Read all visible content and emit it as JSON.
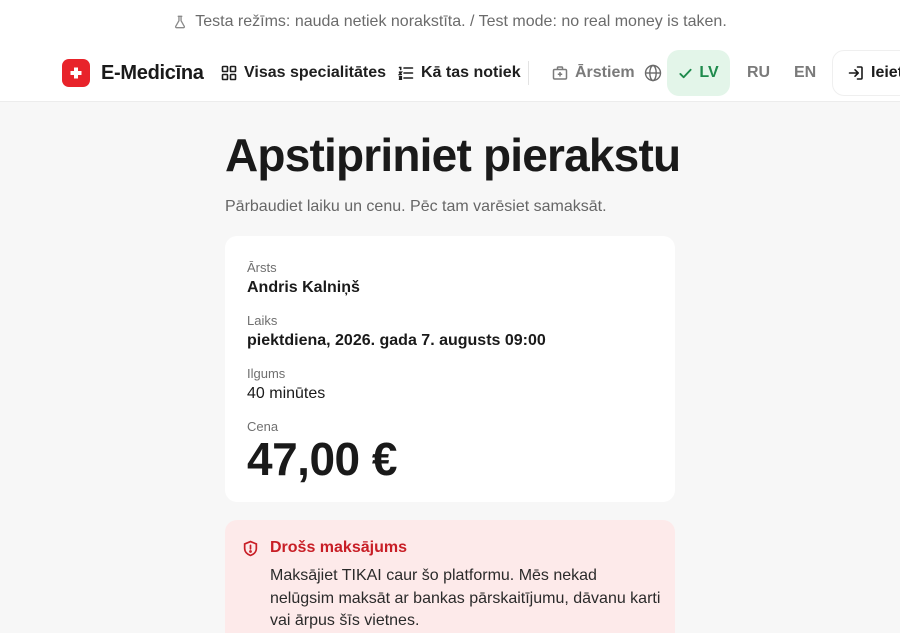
{
  "banner": {
    "text": "Testa režīms: nauda netiek norakstīta. / Test mode: no real money is taken.",
    "icon": "flask-icon"
  },
  "nav": {
    "brand": "E-Medicīna",
    "specialties": "Visas specialitātes",
    "how_it_works": "Kā tas notiek",
    "for_doctors": "Ārstiem",
    "languages": {
      "lv": "LV",
      "ru": "RU",
      "en": "EN",
      "active": "LV"
    },
    "login": "Ieiet"
  },
  "page": {
    "title": "Apstipriniet pierakstu",
    "subtitle": "Pārbaudiet laiku un cenu. Pēc tam varēsiet samaksāt."
  },
  "details": {
    "doctor_label": "Ārsts",
    "doctor_value": "Andris Kalniņš",
    "time_label": "Laiks",
    "time_value": "piektdiena, 2026. gada 7. augusts 09:00",
    "duration_label": "Ilgums",
    "duration_value": "40 minūtes",
    "price_label": "Cena",
    "price_value": "47,00 €"
  },
  "warning": {
    "title": "Drošs maksājums",
    "text": "Maksājiet TIKAI caur šo platformu. Mēs nekad nelūgsim maksāt ar bankas pārskaitījumu, dāvanu karti vai ārpus šīs vietnes."
  },
  "colors": {
    "brand": "#e8232a",
    "active_lang_bg": "#e3f5e9",
    "active_lang_text": "#1e8a4c",
    "warning_bg": "#fdeaea",
    "warning_title": "#c81e26"
  }
}
